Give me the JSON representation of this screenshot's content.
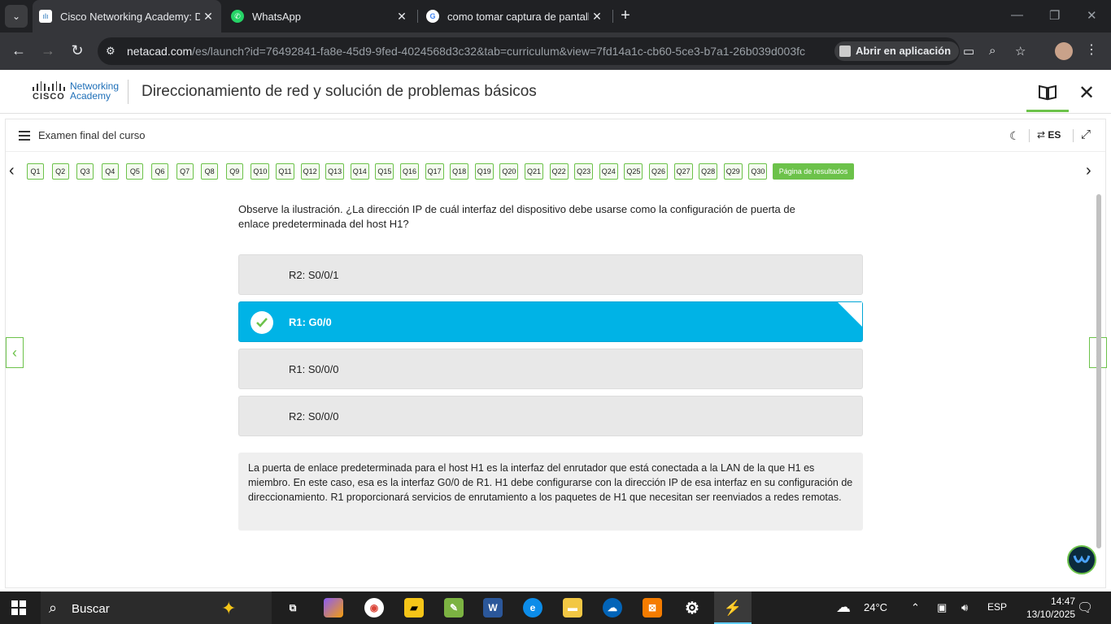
{
  "browser": {
    "tabs": [
      {
        "title": "Cisco Networking Academy: Di",
        "active": true
      },
      {
        "title": "WhatsApp",
        "active": false
      },
      {
        "title": "como tomar captura de pantall",
        "active": false
      }
    ],
    "url_domain": "netacad.com",
    "url_path": "/es/launch?id=76492841-fa8e-45d9-9fed-4024568d3c32&tab=curriculum&view=7fd14a1c-cb60-5ce3-b7a1-26b039d003fc",
    "open_app_label": "Abrir en aplicación"
  },
  "header": {
    "logo_word": "CISCO",
    "logo_line1": "Networking",
    "logo_line2": "Academy",
    "course_title": "Direccionamiento de red y solución de problemas básicos"
  },
  "exam": {
    "title": "Examen final del curso",
    "lang": "ES",
    "questions": [
      "Q1",
      "Q2",
      "Q3",
      "Q4",
      "Q5",
      "Q6",
      "Q7",
      "Q8",
      "Q9",
      "Q10",
      "Q11",
      "Q12",
      "Q13",
      "Q14",
      "Q15",
      "Q16",
      "Q17",
      "Q18",
      "Q19",
      "Q20",
      "Q21",
      "Q22",
      "Q23",
      "Q24",
      "Q25",
      "Q26",
      "Q27",
      "Q28",
      "Q29",
      "Q30"
    ],
    "results_label": "Página de resultados",
    "question_text": "Observe la ilustración. ¿La dirección IP de cuál interfaz del dispositivo debe usarse como la configuración de puerta de enlace predeterminada del host H1?",
    "options": [
      {
        "label": "R2: S0/0/1",
        "selected": false
      },
      {
        "label": "R1: G0/0",
        "selected": true
      },
      {
        "label": "R1: S0/0/0",
        "selected": false
      },
      {
        "label": "R2: S0/0/0",
        "selected": false
      }
    ],
    "explanation": "La puerta de enlace predeterminada para el host H1 es la interfaz del enrutador que está conectada a la LAN de la que H1 es miembro. En este caso, esa es la interfaz G0/0 de R1. H1 debe configurarse con la dirección IP de esa interfaz en su configuración de direccionamiento. R1 proporcionará servicios de enrutamiento a los paquetes de H1 que necesitan ser reenviados a redes remotas."
  },
  "taskbar": {
    "search_label": "Buscar",
    "weather": "24°C",
    "language": "ESP",
    "time": "14:47",
    "date": "13/10/2025"
  },
  "colors": {
    "accent_green": "#6cc24a",
    "selected_blue": "#00b3e6"
  }
}
